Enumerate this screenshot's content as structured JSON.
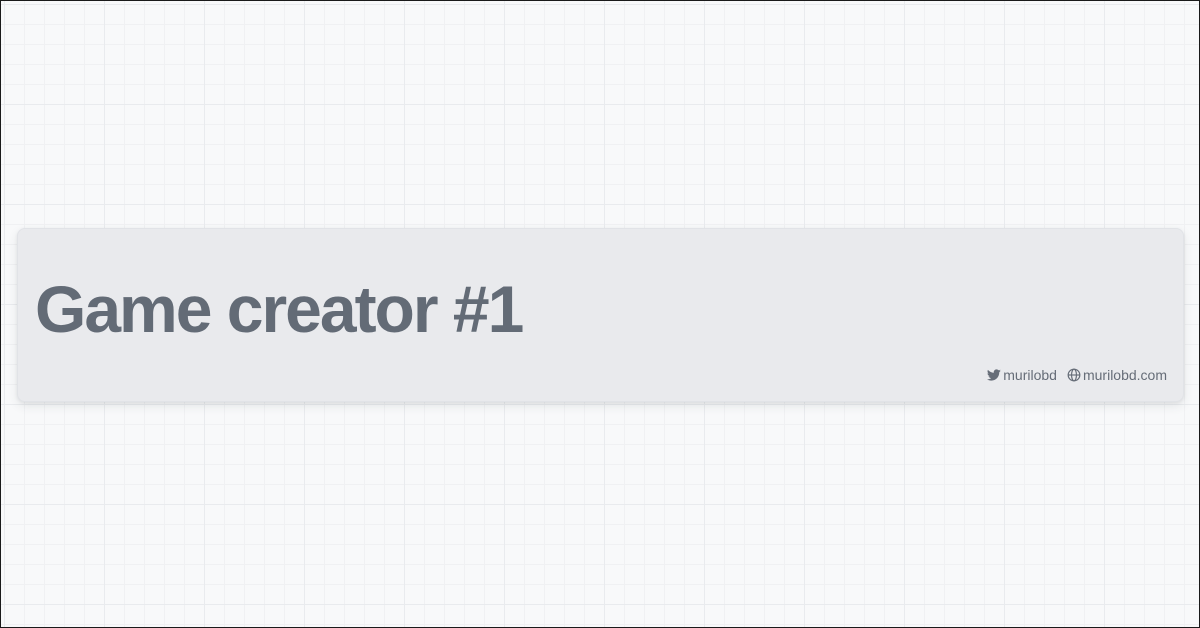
{
  "title": "Game creator #1",
  "links": {
    "twitter": {
      "icon": "twitter-icon",
      "label": "murilobd"
    },
    "website": {
      "icon": "globe-icon",
      "label": "murilobd.com"
    }
  },
  "colors": {
    "background": "#f8f9fa",
    "card": "#e9eaed",
    "title": "#636b76",
    "meta_text": "#666d78"
  }
}
